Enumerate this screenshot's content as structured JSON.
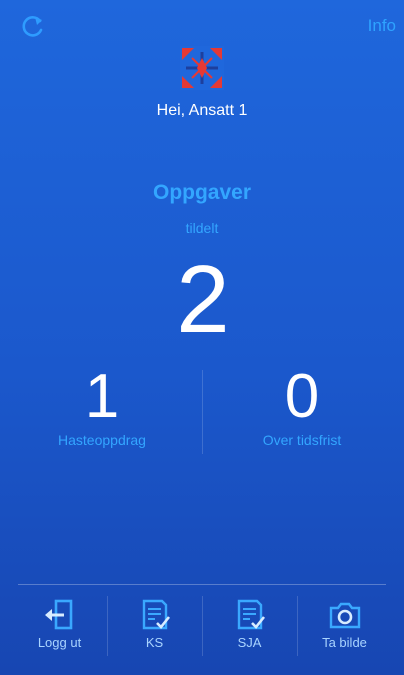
{
  "header": {
    "refresh_icon": "refresh-icon",
    "info_label": "Info"
  },
  "user": {
    "greeting": "Hei, Ansatt 1"
  },
  "tasks": {
    "title": "Oppgaver",
    "assigned_label": "tildelt",
    "assigned_count": "2"
  },
  "stats": [
    {
      "count": "1",
      "label": "Hasteoppdrag"
    },
    {
      "count": "0",
      "label": "Over tidsfrist"
    }
  ],
  "tabbar": {
    "items": [
      {
        "label": "Logg ut",
        "icon": "logout-icon"
      },
      {
        "label": "KS",
        "icon": "checklist-icon"
      },
      {
        "label": "SJA",
        "icon": "checklist-icon"
      },
      {
        "label": "Ta bilde",
        "icon": "camera-icon"
      }
    ]
  },
  "colors": {
    "background_top": "#1f67dc",
    "background_bottom": "#1746b2",
    "accent": "#33a6ff",
    "logo_red": "#e53935"
  }
}
